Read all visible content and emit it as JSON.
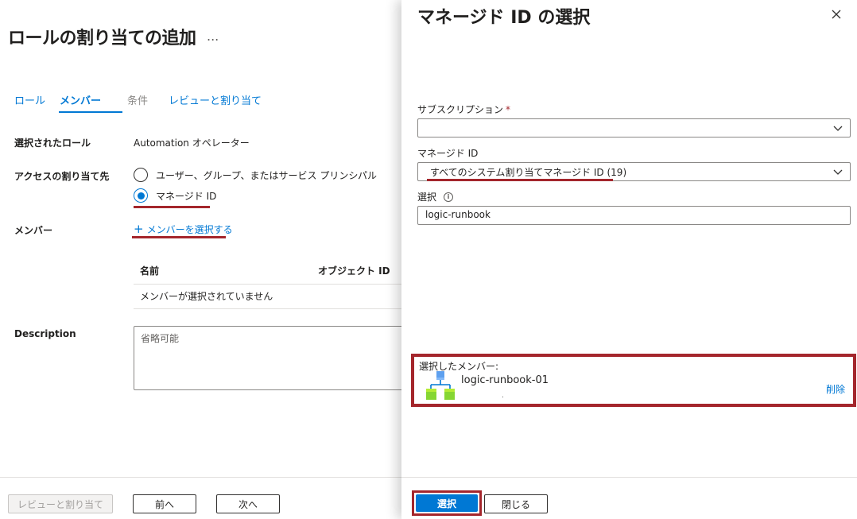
{
  "page": {
    "title": "ロールの割り当ての追加",
    "more_label": "..."
  },
  "tabs": [
    {
      "label": "ロール",
      "state": "link"
    },
    {
      "label": "メンバー",
      "state": "active"
    },
    {
      "label": "条件",
      "state": "disabled"
    },
    {
      "label": "レビューと割り当て",
      "state": "link"
    }
  ],
  "form": {
    "selected_role_label": "選択されたロール",
    "selected_role_value": "Automation オペレーター",
    "assign_access_label": "アクセスの割り当て先",
    "radio_options": [
      {
        "label": "ユーザー、グループ、またはサービス プリンシパル",
        "checked": false
      },
      {
        "label": "マネージド ID",
        "checked": true
      }
    ],
    "members_label": "メンバー",
    "select_members_link": "メンバーを選択する",
    "table": {
      "columns": [
        "名前",
        "オブジェクト ID"
      ],
      "empty_message": "メンバーが選択されていません"
    },
    "description_label": "Description",
    "description_placeholder": "省略可能"
  },
  "footer": {
    "review_assign": "レビューと割り当て",
    "previous": "前へ",
    "next": "次へ"
  },
  "panel": {
    "title": "マネージド ID の選択",
    "subscription_label": "サブスクリプション",
    "subscription_required": "*",
    "subscription_value": "",
    "managed_id_label": "マネージド ID",
    "managed_id_value": "すべてのシステム割り当てマネージド ID (19)",
    "select_label": "選択",
    "select_value": "logic-runbook",
    "selected_members_label": "選択したメンバー:",
    "selected_members": [
      {
        "name": "logic-runbook-01",
        "sub": "."
      }
    ],
    "remove_label": "削除",
    "select_button": "選択",
    "close_button": "閉じる"
  },
  "colors": {
    "accent": "#0078d4",
    "highlight": "#a4262c"
  },
  "icons": [
    "more-icon",
    "radio-icon",
    "plus-icon",
    "close-icon",
    "chevron-down-icon",
    "info-icon",
    "managed-identity-icon"
  ]
}
